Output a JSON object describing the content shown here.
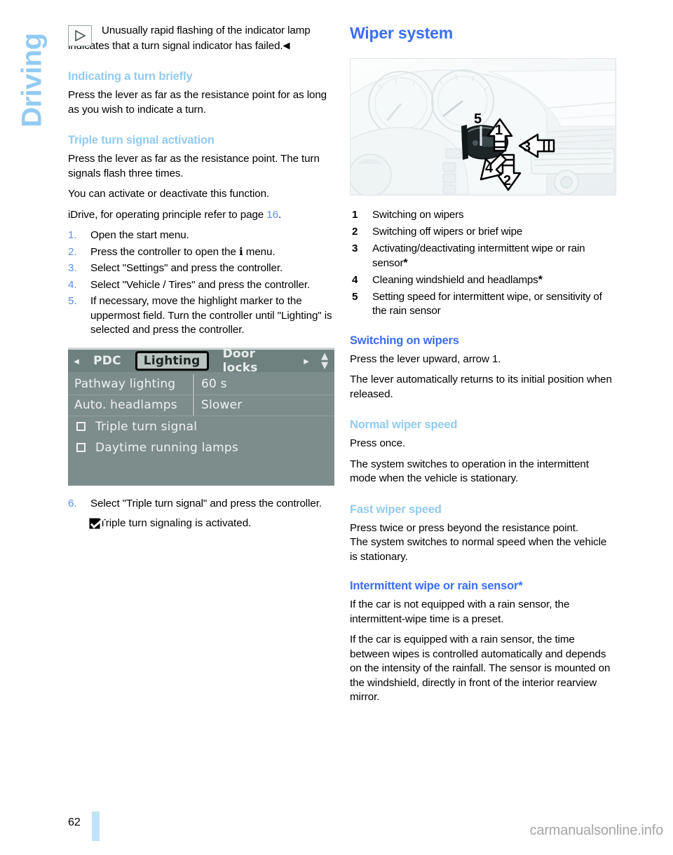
{
  "chapter": {
    "label": "Driving"
  },
  "left_column": {
    "note": {
      "icon": "turn-signal-indicator-triangle-icon",
      "text": "Unusually rapid flashing of the indicator lamp indicates that a turn signal indicator has failed.",
      "end_mark": "◀"
    },
    "section_indicating": {
      "heading": "Indicating a turn briefly",
      "paragraphs": [
        "Press the lever as far as the resistance point for as long as you wish to indicate a turn."
      ]
    },
    "section_triple": {
      "heading": "Triple turn signal activation",
      "paragraphs": [
        "Press the lever as far as the resistance point. The turn signals flash three times.",
        "You can activate or deactivate this function."
      ],
      "idrive_line_prefix": "iDrive, for operating principle refer to page ",
      "idrive_line_page": "16",
      "idrive_line_suffix": ".",
      "steps": [
        {
          "num": "1.",
          "text": "Open the start menu."
        },
        {
          "num": "2.",
          "text": "Press the controller to open the ℹ menu."
        },
        {
          "num": "3.",
          "text": "Select \"Settings\" and press the controller."
        },
        {
          "num": "4.",
          "text": "Select \"Vehicle / Tires\" and press the controller."
        },
        {
          "num": "5.",
          "text": "If necessary, move the highlight marker to the uppermost field. Turn the controller until \"Lighting\" is selected and press the controller."
        }
      ],
      "steps_after": [
        {
          "num": "6.",
          "text": "Select \"Triple turn signal\" and press the controller."
        }
      ],
      "result": {
        "icon": "checked-checkbox-icon",
        "text": "Triple turn signaling is activated."
      }
    },
    "idrive_screen": {
      "nav_prev_icon": "triangle-left-icon",
      "nav_next_icon": "triangle-right-icon",
      "scroll_icon": "up-down-scroll-icon",
      "tabs": [
        {
          "label": "PDC",
          "selected": false
        },
        {
          "label": "Lighting",
          "selected": true
        },
        {
          "label": "Door locks",
          "selected": false
        }
      ],
      "rows": [
        {
          "label": "Pathway lighting",
          "value": "60 s"
        },
        {
          "label": "Auto. headlamps",
          "value": "Slower"
        }
      ],
      "checkboxes": [
        {
          "label": "Triple turn signal",
          "checked": false
        },
        {
          "label": "Daytime running lamps",
          "checked": false
        }
      ]
    }
  },
  "right_column": {
    "title": "Wiper system",
    "figure": {
      "name": "wiper-stalk-illustration",
      "callouts": [
        "1",
        "2",
        "3",
        "4",
        "5"
      ]
    },
    "legend": [
      {
        "num": "1",
        "text": "Switching on wipers",
        "asterisk": false
      },
      {
        "num": "2",
        "text": "Switching off wipers or brief wipe",
        "asterisk": false
      },
      {
        "num": "3",
        "text": "Activating/deactivating intermittent wipe or rain sensor",
        "asterisk": true
      },
      {
        "num": "4",
        "text": "Cleaning windshield and headlamps",
        "asterisk": true
      },
      {
        "num": "5",
        "text": "Setting speed for intermittent wipe, or sensitivity of the rain sensor",
        "asterisk": false
      }
    ],
    "section_switching": {
      "heading": "Switching on wipers",
      "paragraphs": [
        "Press the lever upward, arrow 1.",
        "The lever automatically returns to its initial position when released."
      ]
    },
    "section_normal": {
      "heading": "Normal wiper speed",
      "paragraphs": [
        "Press once.",
        "The system switches to operation in the intermittent mode when the vehicle is stationary."
      ]
    },
    "section_fast": {
      "heading": "Fast wiper speed",
      "paragraphs": [
        "Press twice or press beyond the resistance point.",
        "The system switches to normal speed when the vehicle is stationary."
      ]
    },
    "section_intermittent": {
      "heading": "Intermittent wipe or rain sensor*",
      "paragraphs": [
        "If the car is not equipped with a rain sensor, the intermittent-wipe time is a preset.",
        "If the car is equipped with a rain sensor, the time between wipes is controlled automatically and depends on the intensity of the rainfall. The sensor is mounted on the windshield, directly in front of the interior rearview mirror."
      ]
    }
  },
  "footer": {
    "page_number": "62",
    "watermark": "carmanualsonline.info"
  },
  "colors": {
    "heading_blue": "#3b6ef5",
    "subheading_blue": "#92cbf2",
    "accent_light": "#bfe3f8",
    "idrive_bg": "#7d8d8c"
  }
}
